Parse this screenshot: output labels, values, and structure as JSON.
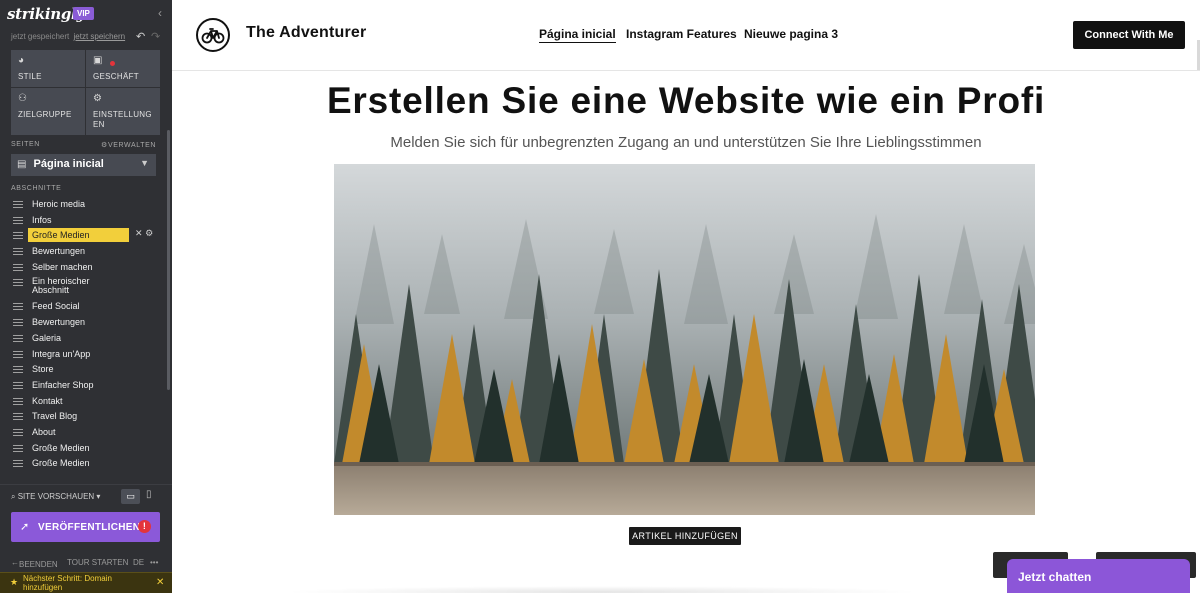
{
  "sidebar": {
    "logo": "strikingly",
    "badge": "VIP",
    "save_status": "jetzt gespeichert",
    "save_now": "jetzt speichern",
    "settings": [
      {
        "label": "STILE",
        "icon": "palette-icon"
      },
      {
        "label": "GESCHÄFT",
        "icon": "bag-icon"
      },
      {
        "label": "ZIELGRUPPE",
        "icon": "people-icon"
      },
      {
        "label": "EINSTELLUNG EN",
        "icon": "gear-icon"
      }
    ],
    "pages_header": "SEITEN",
    "manage": "VERWALTEN",
    "current_page": "Página inicial",
    "sections_header": "ABSCHNITTE",
    "sections": [
      "Heroic media",
      "Infos",
      "Große Medien",
      "Bewertungen",
      "Selber machen",
      "Ein heroischer Abschnitt",
      "Feed Social",
      "Bewertungen",
      "Galeria",
      "Integra un'App",
      "Store",
      "Einfacher Shop",
      "Kontakt",
      "Travel Blog",
      "About",
      "Große Medien",
      "Große Medien"
    ],
    "active_section_index": 2,
    "preview": "SITE VORSCHAUEN",
    "publish": "VERÖFFENTLICHEN",
    "bottom": {
      "exit": "BEENDEN",
      "tour": "TOUR STARTEN",
      "lang": "DE"
    },
    "next_step": "Nächster Schritt: Domain hinzufügen"
  },
  "site": {
    "brand": "The Adventurer",
    "nav": [
      "Página inicial",
      "Instagram Features",
      "Nieuwe pagina 3"
    ],
    "cta": "Connect With Me",
    "title": "Erstellen Sie eine Website wie ein Profi",
    "subtitle": "Melden Sie sich für unbegrenzten Zugang an und unterstützen Sie Ihre Lieblingsstimmen",
    "add_article": "ARTIKEL HINZUFÜGEN",
    "chat": "Jetzt chatten"
  },
  "colors": {
    "sidebar_bg": "#2f3034",
    "accent_purple": "#8b59d9",
    "active_yellow": "#f2cf3b",
    "alert_red": "#e3343b"
  }
}
